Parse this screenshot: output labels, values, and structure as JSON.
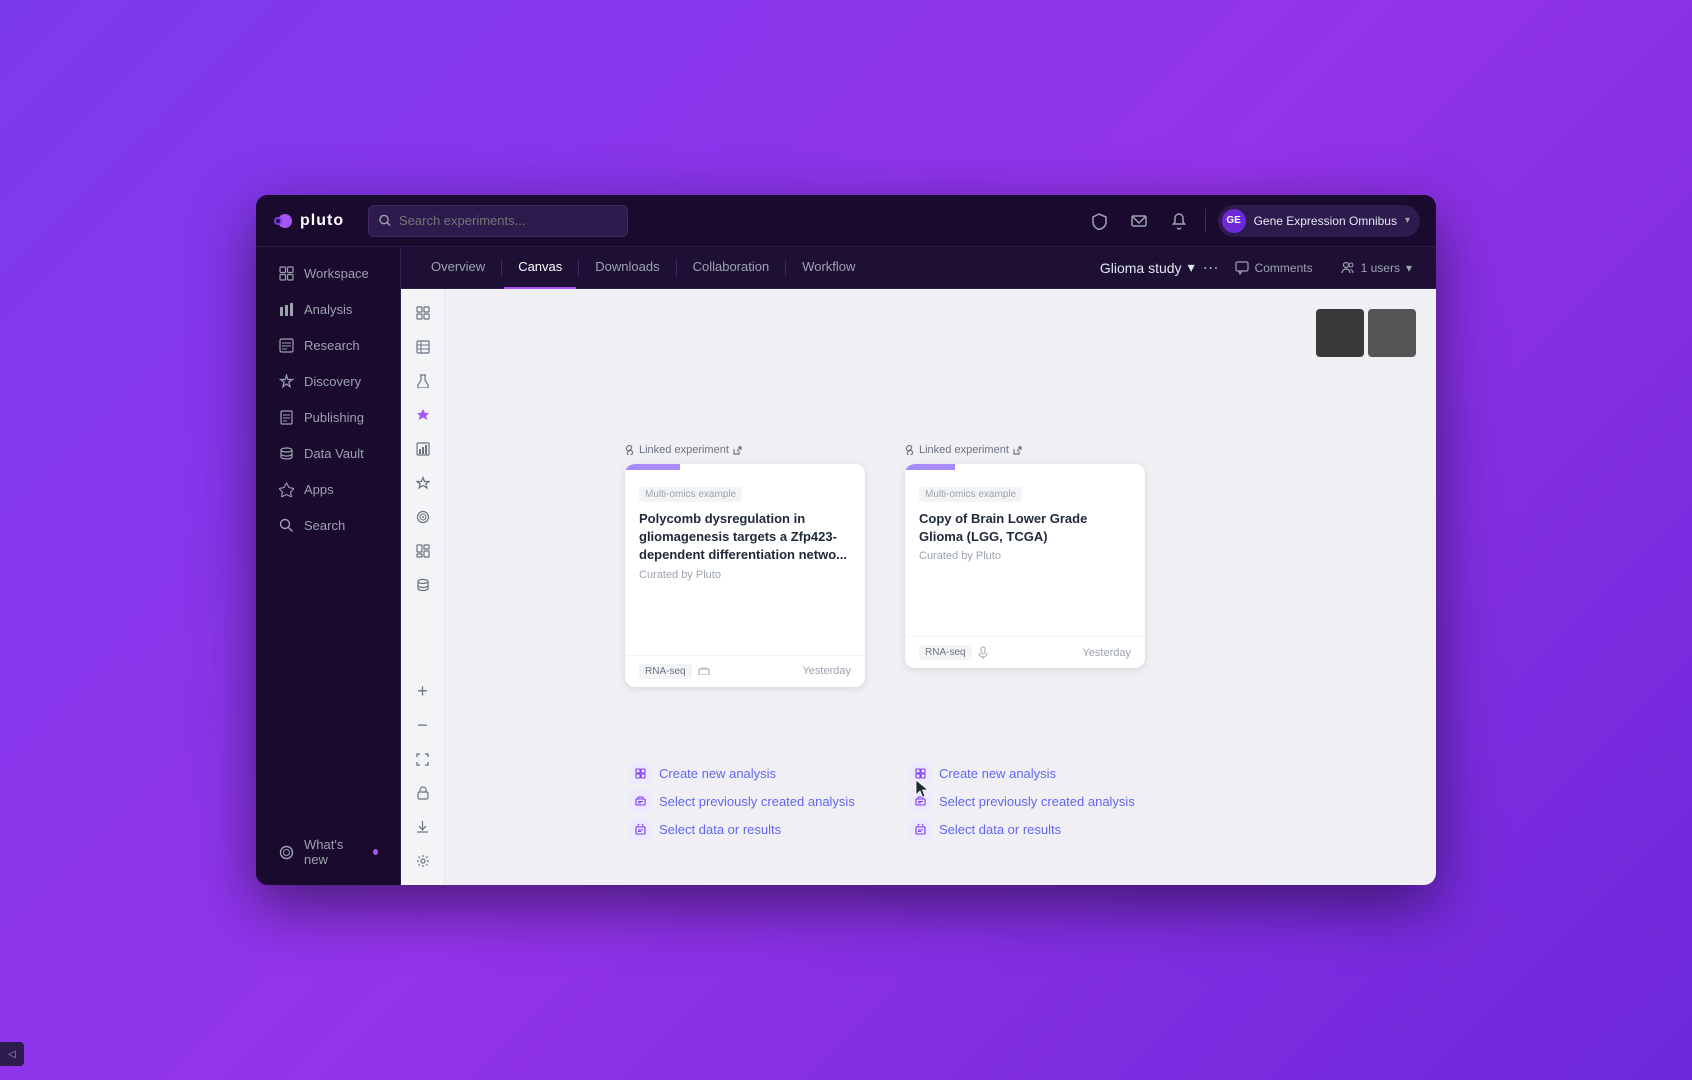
{
  "app": {
    "logo_text": "pluto",
    "window_title": "Pluto"
  },
  "header": {
    "search_placeholder": "Search experiments...",
    "icons": [
      "shield",
      "mail",
      "bell"
    ],
    "user_name": "Gene Expression Omnibus",
    "user_initials": "GE"
  },
  "nav": {
    "items": [
      {
        "label": "Workspace",
        "icon": "⊞",
        "active": false
      },
      {
        "label": "Analysis",
        "icon": "📊",
        "active": false
      },
      {
        "label": "Research",
        "icon": "⊟",
        "active": false
      },
      {
        "label": "Discovery",
        "icon": "✦",
        "active": false
      },
      {
        "label": "Publishing",
        "icon": "📋",
        "active": false
      },
      {
        "label": "Data Vault",
        "icon": "🗄",
        "active": false
      },
      {
        "label": "Apps",
        "icon": "⚡",
        "active": false
      },
      {
        "label": "Search",
        "icon": "🔍",
        "active": false
      },
      {
        "label": "What's new",
        "icon": "◎",
        "active": false,
        "has_dot": true
      }
    ]
  },
  "tabs": {
    "items": [
      {
        "label": "Overview",
        "active": false
      },
      {
        "label": "Canvas",
        "active": true
      },
      {
        "label": "Downloads",
        "active": false
      },
      {
        "label": "Collaboration",
        "active": false
      },
      {
        "label": "Workflow",
        "active": false
      }
    ],
    "study_title": "Glioma study",
    "comments_label": "Comments",
    "users_label": "1 users"
  },
  "cards": [
    {
      "linked_label": "Linked experiment",
      "tag": "Multi-omics example",
      "title": "Polycomb dysregulation in gliomagenesis targets a Zfp423-dependent differentiation netwo...",
      "curator": "Curated by Pluto",
      "badge": "RNA-seq",
      "date": "Yesterday"
    },
    {
      "linked_label": "Linked experiment",
      "tag": "Multi-omics example",
      "title": "Copy of Brain Lower Grade Glioma (LGG, TCGA)",
      "curator": "Curated by Pluto",
      "badge": "RNA-seq",
      "date": "Yesterday"
    }
  ],
  "actions_left": [
    {
      "label": "Create new analysis"
    },
    {
      "label": "Select previously created analysis"
    },
    {
      "label": "Select data or results"
    }
  ],
  "actions_right": [
    {
      "label": "Create new analysis"
    },
    {
      "label": "Select previously created analysis"
    },
    {
      "label": "Select data or results"
    }
  ],
  "swatches": [
    {
      "color": "#3d3d3d"
    },
    {
      "color": "#555555"
    }
  ],
  "zoom": {
    "plus": "+",
    "minus": "−",
    "fit": "⛶",
    "lock": "🔒",
    "download": "⬇",
    "settings": "⚙"
  }
}
